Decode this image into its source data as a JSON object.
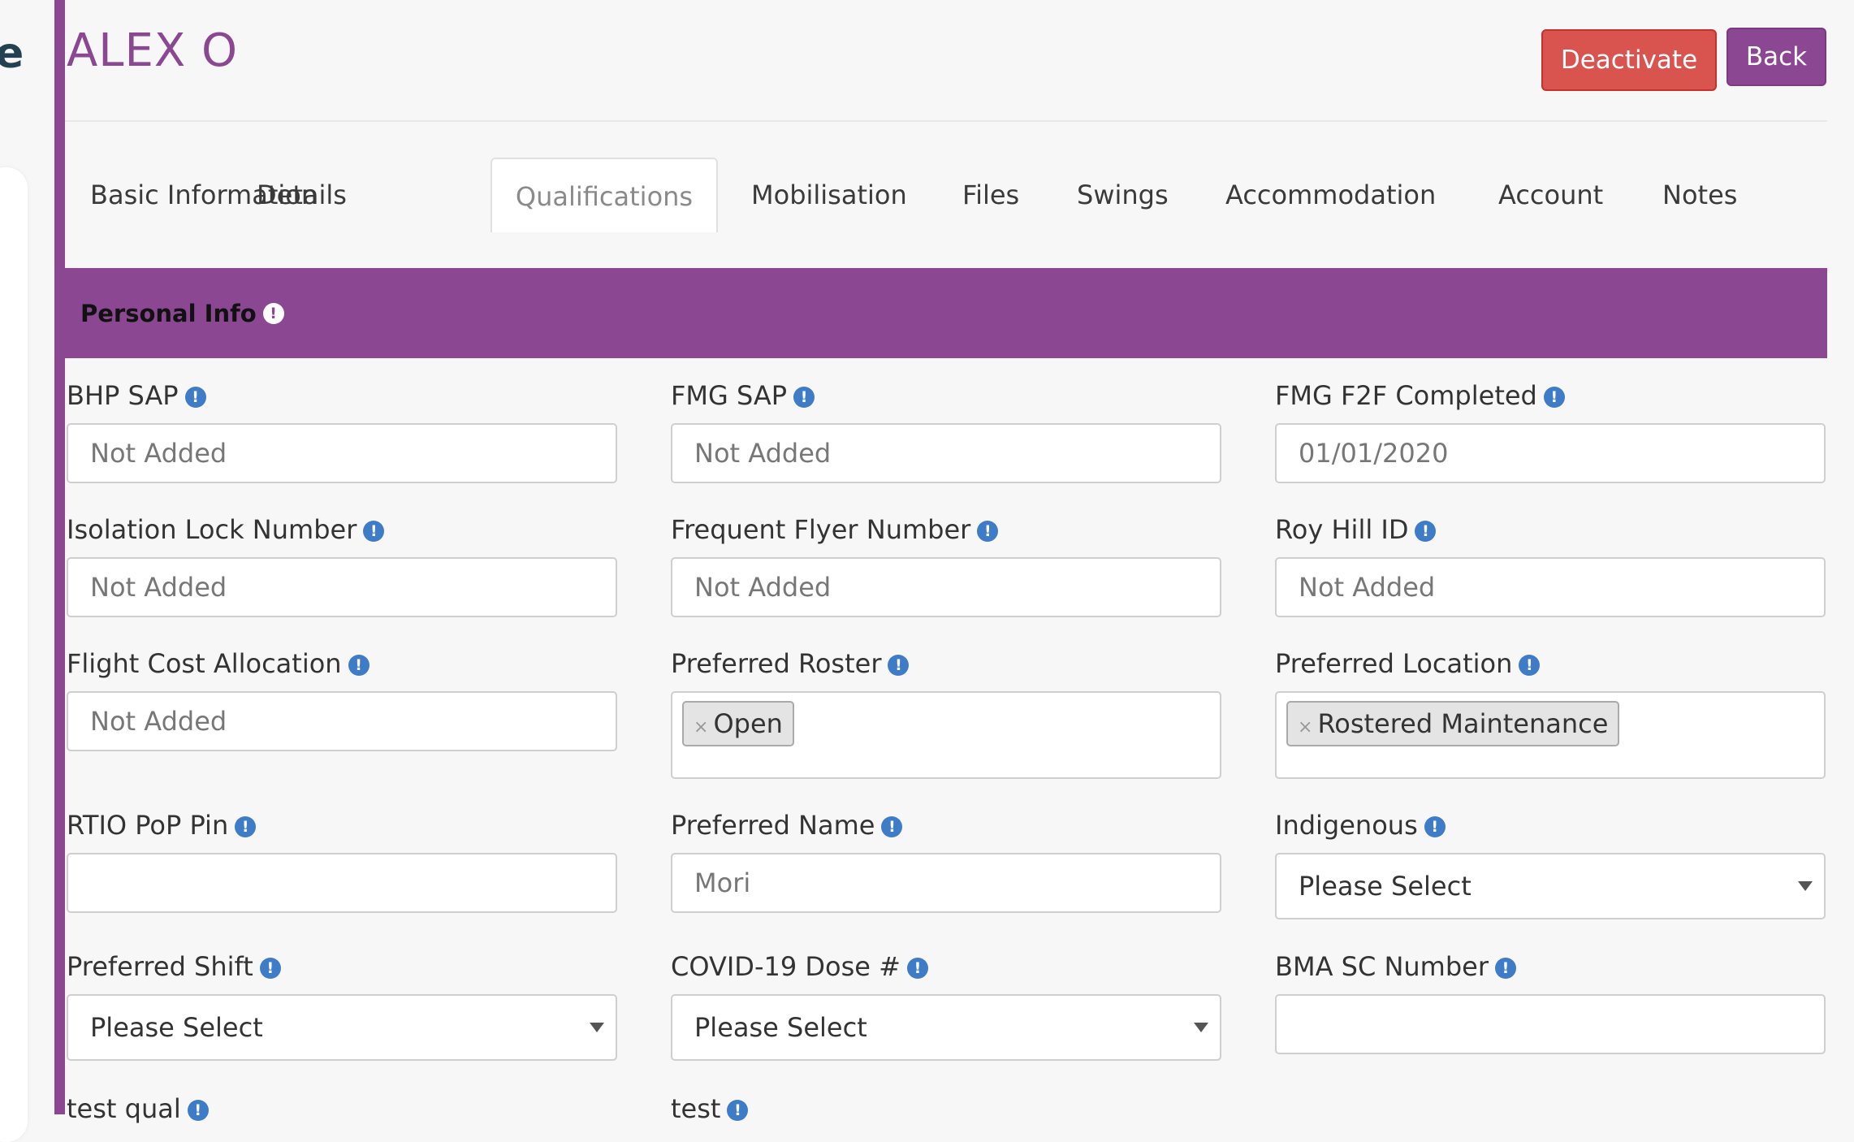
{
  "sidebar": {
    "glyph": "e"
  },
  "header": {
    "title": "ALEX O",
    "deactivate_label": "Deactivate",
    "back_label": "Back"
  },
  "tabs": [
    {
      "label": "Basic Information",
      "active": false
    },
    {
      "label": "Details",
      "active": false
    },
    {
      "label": "Qualifications",
      "active": true
    },
    {
      "label": "Mobilisation",
      "active": false
    },
    {
      "label": "Files",
      "active": false
    },
    {
      "label": "Swings",
      "active": false
    },
    {
      "label": "Accommodation",
      "active": false
    },
    {
      "label": "Account",
      "active": false
    },
    {
      "label": "Notes",
      "active": false
    }
  ],
  "section": {
    "title": "Personal Info",
    "info_icon": "!"
  },
  "fields": {
    "bhp_sap": {
      "label": "BHP SAP",
      "value": "Not Added"
    },
    "fmg_sap": {
      "label": "FMG SAP",
      "value": "Not Added"
    },
    "fmg_f2f": {
      "label": "FMG F2F Completed",
      "value": "01/01/2020"
    },
    "isolation_lock": {
      "label": "Isolation Lock Number",
      "value": "Not Added"
    },
    "frequent_flyer": {
      "label": "Frequent Flyer Number",
      "value": "Not Added"
    },
    "roy_hill_id": {
      "label": "Roy Hill ID",
      "value": "Not Added"
    },
    "flight_cost": {
      "label": "Flight Cost Allocation",
      "value": "Not Added"
    },
    "preferred_roster": {
      "label": "Preferred Roster",
      "tag": "Open",
      "tag_remove": "×"
    },
    "preferred_location": {
      "label": "Preferred Location",
      "tag": "Rostered Maintenance",
      "tag_remove": "×"
    },
    "rtio_pop_pin": {
      "label": "RTIO PoP Pin",
      "value": ""
    },
    "preferred_name": {
      "label": "Preferred Name",
      "value": "Mori"
    },
    "indigenous": {
      "label": "Indigenous",
      "value": "Please Select"
    },
    "preferred_shift": {
      "label": "Preferred Shift",
      "value": "Please Select"
    },
    "covid_dose": {
      "label": "COVID-19 Dose #",
      "value": "Please Select"
    },
    "bma_sc_number": {
      "label": "BMA SC Number",
      "value": ""
    },
    "test_qual": {
      "label": "test qual"
    },
    "test": {
      "label": "test"
    }
  },
  "colors": {
    "brand_purple": "#8c4793",
    "danger_red": "#d9534f",
    "info_blue": "#3f7cc7"
  },
  "icons": {
    "info": "info-circle-icon",
    "remove": "close-icon",
    "dropdown": "caret-down-icon"
  }
}
